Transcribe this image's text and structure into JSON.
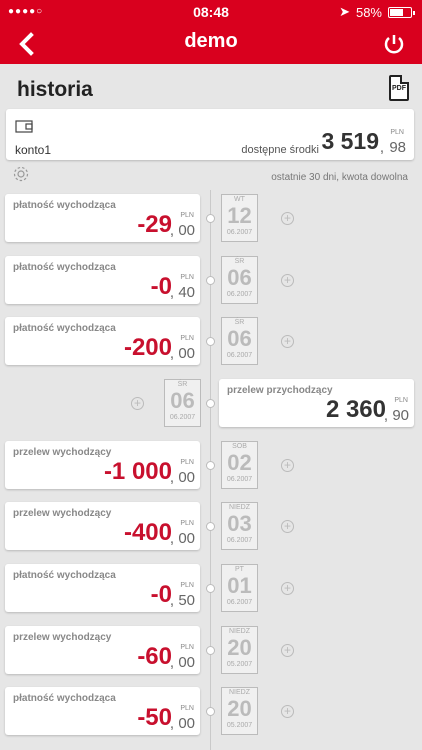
{
  "status": {
    "dots": "●●●●○",
    "time": "08:48",
    "battery": "58%"
  },
  "nav": {
    "title": "demo",
    "back": "‹"
  },
  "page_title": "historia",
  "pdf_label": "PDF",
  "account": {
    "name": "konto1",
    "balance_label": "dostępne środki",
    "balance_main": "3 519",
    "balance_dec": "98",
    "currency": "PLN"
  },
  "filter_text": "ostatnie 30 dni, kwota dowolna",
  "transactions": [
    {
      "title": "płatność wychodząca",
      "amount": "-29",
      "dec": "00",
      "currency": "PLN",
      "day_name": "WT",
      "day": "12",
      "month": "06.2007"
    },
    {
      "title": "płatność wychodząca",
      "amount": "-0",
      "dec": "40",
      "currency": "PLN",
      "day_name": "ŚR",
      "day": "06",
      "month": "06.2007"
    },
    {
      "title": "płatność wychodząca",
      "amount": "-200",
      "dec": "00",
      "currency": "PLN",
      "day_name": "ŚR",
      "day": "06",
      "month": "06.2007"
    },
    {
      "title": "przelew przychodzący",
      "amount": "2 360",
      "dec": "90",
      "currency": "PLN",
      "day_name": "ŚR",
      "day": "06",
      "month": "06.2007"
    },
    {
      "title": "przelew wychodzący",
      "amount": "-1 000",
      "dec": "00",
      "currency": "PLN",
      "day_name": "SOB",
      "day": "02",
      "month": "06.2007"
    },
    {
      "title": "przelew wychodzący",
      "amount": "-400",
      "dec": "00",
      "currency": "PLN",
      "day_name": "NIEDZ",
      "day": "03",
      "month": "06.2007"
    },
    {
      "title": "płatność wychodząca",
      "amount": "-0",
      "dec": "50",
      "currency": "PLN",
      "day_name": "PT",
      "day": "01",
      "month": "06.2007"
    },
    {
      "title": "przelew wychodzący",
      "amount": "-60",
      "dec": "00",
      "currency": "PLN",
      "day_name": "NIEDZ",
      "day": "20",
      "month": "05.2007"
    },
    {
      "title": "płatność wychodząca",
      "amount": "-50",
      "dec": "00",
      "currency": "PLN",
      "day_name": "NIEDZ",
      "day": "20",
      "month": "05.2007"
    }
  ]
}
